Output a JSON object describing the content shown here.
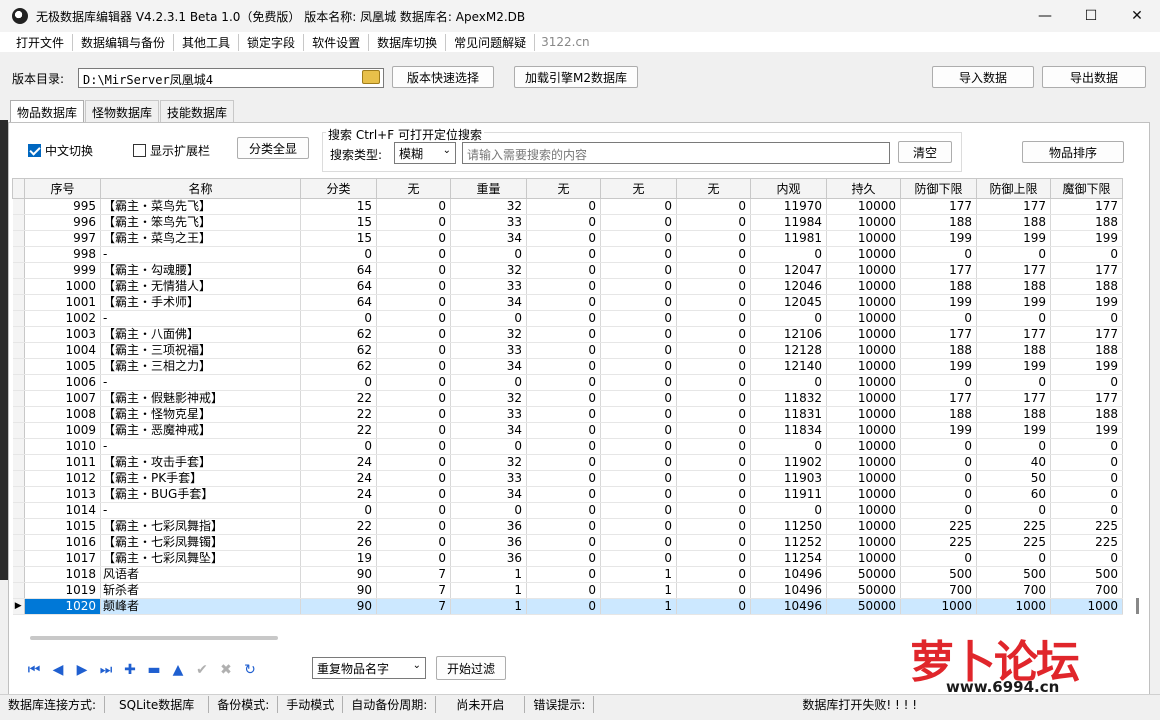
{
  "window": {
    "title": "无极数据库编辑器 V4.2.3.1    Beta 1.0（免费版）    版本名称: 凤凰城    数据库名: ApexM2.DB",
    "minimize": "—",
    "maximize": "☐",
    "close": "✕"
  },
  "menu": {
    "items": [
      "打开文件",
      "数据编辑与备份",
      "其他工具",
      "锁定字段",
      "软件设置",
      "数据库切换",
      "常见问题解疑"
    ],
    "site": "3122.cn"
  },
  "toolbar": {
    "dir_label": "版本目录:",
    "dir_value": "D:\\MirServer凤凰城4",
    "quick_select": "版本快速选择",
    "load_engine": "加载引擎M2数据库",
    "import": "导入数据",
    "export": "导出数据"
  },
  "tabs": [
    "物品数据库",
    "怪物数据库",
    "技能数据库"
  ],
  "filters": {
    "chinese_toggle": "中文切换",
    "chinese_checked": true,
    "show_ext": "显示扩展栏",
    "show_ext_checked": false,
    "category_all": "分类全显",
    "search_group_title": "搜索   Ctrl+F 可打开定位搜索",
    "search_type_label": "搜索类型:",
    "search_type_value": "模糊",
    "search_placeholder": "请输入需要搜索的内容",
    "clear": "清空",
    "sort_items": "物品排序"
  },
  "table": {
    "headers": [
      "序号",
      "名称",
      "分类",
      "无",
      "重量",
      "无",
      "无",
      "无",
      "内观",
      "持久",
      "防御下限",
      "防御上限",
      "魔御下限"
    ],
    "rows": [
      [
        "995",
        "【霸主・菜鸟先飞】",
        "15",
        "0",
        "32",
        "0",
        "0",
        "0",
        "11970",
        "10000",
        "177",
        "177",
        "177"
      ],
      [
        "996",
        "【霸主・笨鸟先飞】",
        "15",
        "0",
        "33",
        "0",
        "0",
        "0",
        "11984",
        "10000",
        "188",
        "188",
        "188"
      ],
      [
        "997",
        "【霸主・菜鸟之王】",
        "15",
        "0",
        "34",
        "0",
        "0",
        "0",
        "11981",
        "10000",
        "199",
        "199",
        "199"
      ],
      [
        "998",
        "-",
        "0",
        "0",
        "0",
        "0",
        "0",
        "0",
        "0",
        "10000",
        "0",
        "0",
        "0"
      ],
      [
        "999",
        "【霸主・勾魂腰】",
        "64",
        "0",
        "32",
        "0",
        "0",
        "0",
        "12047",
        "10000",
        "177",
        "177",
        "177"
      ],
      [
        "1000",
        "【霸主・无情猎人】",
        "64",
        "0",
        "33",
        "0",
        "0",
        "0",
        "12046",
        "10000",
        "188",
        "188",
        "188"
      ],
      [
        "1001",
        "【霸主・手术师】",
        "64",
        "0",
        "34",
        "0",
        "0",
        "0",
        "12045",
        "10000",
        "199",
        "199",
        "199"
      ],
      [
        "1002",
        "-",
        "0",
        "0",
        "0",
        "0",
        "0",
        "0",
        "0",
        "10000",
        "0",
        "0",
        "0"
      ],
      [
        "1003",
        "【霸主・八面佛】",
        "62",
        "0",
        "32",
        "0",
        "0",
        "0",
        "12106",
        "10000",
        "177",
        "177",
        "177"
      ],
      [
        "1004",
        "【霸主・三项祝福】",
        "62",
        "0",
        "33",
        "0",
        "0",
        "0",
        "12128",
        "10000",
        "188",
        "188",
        "188"
      ],
      [
        "1005",
        "【霸主・三相之力】",
        "62",
        "0",
        "34",
        "0",
        "0",
        "0",
        "12140",
        "10000",
        "199",
        "199",
        "199"
      ],
      [
        "1006",
        "-",
        "0",
        "0",
        "0",
        "0",
        "0",
        "0",
        "0",
        "10000",
        "0",
        "0",
        "0"
      ],
      [
        "1007",
        "【霸主・假魅影神戒】",
        "22",
        "0",
        "32",
        "0",
        "0",
        "0",
        "11832",
        "10000",
        "177",
        "177",
        "177"
      ],
      [
        "1008",
        "【霸主・怪物克星】",
        "22",
        "0",
        "33",
        "0",
        "0",
        "0",
        "11831",
        "10000",
        "188",
        "188",
        "188"
      ],
      [
        "1009",
        "【霸主・恶魔神戒】",
        "22",
        "0",
        "34",
        "0",
        "0",
        "0",
        "11834",
        "10000",
        "199",
        "199",
        "199"
      ],
      [
        "1010",
        "-",
        "0",
        "0",
        "0",
        "0",
        "0",
        "0",
        "0",
        "10000",
        "0",
        "0",
        "0"
      ],
      [
        "1011",
        "【霸主・攻击手套】",
        "24",
        "0",
        "32",
        "0",
        "0",
        "0",
        "11902",
        "10000",
        "0",
        "40",
        "0"
      ],
      [
        "1012",
        "【霸主・PK手套】",
        "24",
        "0",
        "33",
        "0",
        "0",
        "0",
        "11903",
        "10000",
        "0",
        "50",
        "0"
      ],
      [
        "1013",
        "【霸主・BUG手套】",
        "24",
        "0",
        "34",
        "0",
        "0",
        "0",
        "11911",
        "10000",
        "0",
        "60",
        "0"
      ],
      [
        "1014",
        "-",
        "0",
        "0",
        "0",
        "0",
        "0",
        "0",
        "0",
        "10000",
        "0",
        "0",
        "0"
      ],
      [
        "1015",
        "【霸主・七彩凤舞指】",
        "22",
        "0",
        "36",
        "0",
        "0",
        "0",
        "11250",
        "10000",
        "225",
        "225",
        "225"
      ],
      [
        "1016",
        "【霸主・七彩凤舞镯】",
        "26",
        "0",
        "36",
        "0",
        "0",
        "0",
        "11252",
        "10000",
        "225",
        "225",
        "225"
      ],
      [
        "1017",
        "【霸主・七彩凤舞坠】",
        "19",
        "0",
        "36",
        "0",
        "0",
        "0",
        "11254",
        "10000",
        "0",
        "0",
        "0"
      ],
      [
        "1018",
        "风语者",
        "90",
        "7",
        "1",
        "0",
        "1",
        "0",
        "10496",
        "50000",
        "500",
        "500",
        "500"
      ],
      [
        "1019",
        "斩杀者",
        "90",
        "7",
        "1",
        "0",
        "1",
        "0",
        "10496",
        "50000",
        "700",
        "700",
        "700"
      ],
      [
        "1020",
        "颠峰者",
        "90",
        "7",
        "1",
        "0",
        "1",
        "0",
        "10496",
        "50000",
        "1000",
        "1000",
        "1000"
      ]
    ],
    "selected_row": "1020"
  },
  "bottom": {
    "nav_icons": [
      "first-icon",
      "prev-icon",
      "next-icon",
      "last-icon",
      "add-icon",
      "remove-icon",
      "up-icon",
      "confirm-icon",
      "cancel-icon",
      "refresh-icon"
    ],
    "dup_select": "重复物品名字",
    "start_filter": "开始过滤"
  },
  "status": {
    "conn_label": "数据库连接方式:",
    "conn_value": "SQLite数据库",
    "backup_label": "备份模式:",
    "backup_value": "手动模式",
    "auto_label": "自动备份周期:",
    "auto_value": "尚未开启",
    "err_label": "错误提示:",
    "err_value": "数据库打开失败! ! ! !"
  },
  "watermark": {
    "logo_text": "萝卜论坛",
    "url": "www.6994.cn"
  }
}
